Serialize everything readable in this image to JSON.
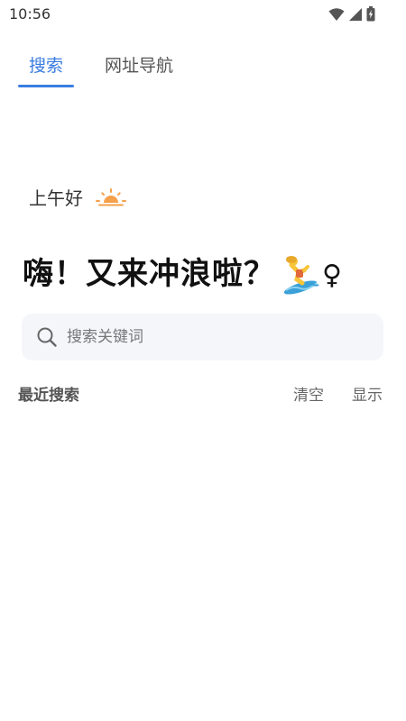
{
  "status_bar": {
    "time": "10:56",
    "icons": [
      "wifi-icon",
      "signal-icon",
      "battery-charging-icon"
    ]
  },
  "tabs": [
    {
      "label": "搜索",
      "active": true
    },
    {
      "label": "网址导航",
      "active": false
    }
  ],
  "colors": {
    "accent": "#3a7de0",
    "search_bg": "#f4f6fa"
  },
  "greeting": {
    "text": "上午好",
    "icon": "sunrise-icon"
  },
  "headline": {
    "text": "嗨！又来冲浪啦？",
    "emoji": "woman-surfing-icon",
    "female_sign": "♀"
  },
  "search": {
    "placeholder": "搜索关键词",
    "value": ""
  },
  "recent": {
    "title": "最近搜索",
    "clear_label": "清空",
    "show_label": "显示"
  }
}
